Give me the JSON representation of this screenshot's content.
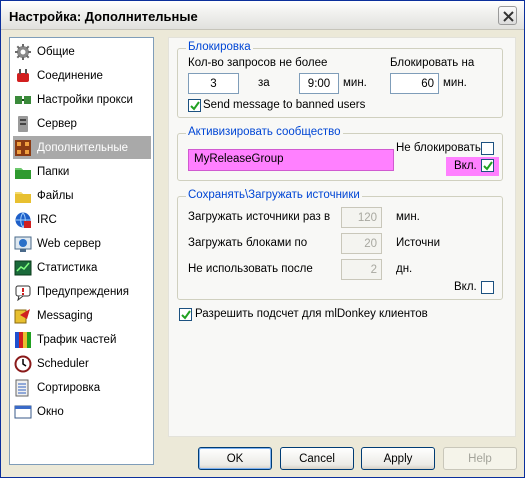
{
  "window": {
    "title": "Настройка: Дополнительные"
  },
  "sidebar": {
    "items": [
      {
        "label": "Общие",
        "icon": "gear-icon"
      },
      {
        "label": "Соединение",
        "icon": "plug-icon"
      },
      {
        "label": "Настройки прокси",
        "icon": "proxy-icon"
      },
      {
        "label": "Сервер",
        "icon": "server-icon"
      },
      {
        "label": "Дополнительные",
        "icon": "advanced-icon",
        "selected": true
      },
      {
        "label": "Папки",
        "icon": "folder-icon"
      },
      {
        "label": "Файлы",
        "icon": "files-icon"
      },
      {
        "label": "IRC",
        "icon": "irc-icon"
      },
      {
        "label": "Web сервер",
        "icon": "web-server-icon"
      },
      {
        "label": "Статистика",
        "icon": "statistics-icon"
      },
      {
        "label": "Предупреждения",
        "icon": "notifications-icon"
      },
      {
        "label": "Messaging",
        "icon": "messaging-icon"
      },
      {
        "label": "Трафик частей",
        "icon": "traffic-icon"
      },
      {
        "label": "Scheduler",
        "icon": "clock-icon"
      },
      {
        "label": "Сортировка",
        "icon": "sort-icon"
      },
      {
        "label": "Окно",
        "icon": "window-icon"
      }
    ]
  },
  "block": {
    "title": "Блокировка",
    "requests_label": "Кол-во запросов не более",
    "block_for_label": "Блокировать на",
    "requests_value": "3",
    "in_label": "за",
    "time_value": "9:00",
    "min1": "мин.",
    "block_value": "60",
    "min2": "мин.",
    "send_message_label": "Send message to banned users",
    "send_message_checked": true
  },
  "community": {
    "title": "Активизировать сообщество",
    "name_value": "MyReleaseGroup",
    "no_block_label": "Не блокировать",
    "no_block_checked": false,
    "enabled_label": "Вкл.",
    "enabled_checked": true,
    "highlight_color": "#ff80ff"
  },
  "sources": {
    "title": "Сохранять\\Загружать источники",
    "load_every_label": "Загружать источники раз в",
    "load_every_value": "120",
    "load_every_unit": "мин.",
    "load_blocks_label": "Загружать блоками по",
    "load_blocks_value": "20",
    "load_blocks_unit": "Источни",
    "unused_after_label": "Не использовать после",
    "unused_after_value": "2",
    "unused_after_unit": "дн.",
    "enabled_label": "Вкл.",
    "enabled_checked": false
  },
  "mldonkey": {
    "label": "Разрешить подсчет для mlDonkey клиентов",
    "checked": true
  },
  "buttons": {
    "ok": "OK",
    "cancel": "Cancel",
    "apply": "Apply",
    "help": "Help"
  }
}
